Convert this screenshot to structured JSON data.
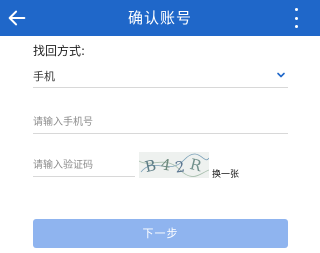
{
  "header": {
    "title": "确认账号",
    "back_icon": "arrow-left-icon",
    "menu_icon": "more-vertical-icon",
    "bg_color": "#1f67c9"
  },
  "form": {
    "recovery_label": "找回方式:",
    "recovery_method": {
      "value": "手机",
      "icon": "chevron-down-icon"
    },
    "phone_placeholder": "请输入手机号",
    "code_placeholder": "请输入验证码",
    "captcha_text": "B42R",
    "swap_captcha": "换一张",
    "next_button": "下一步",
    "next_button_color": "#8fb4ef"
  }
}
